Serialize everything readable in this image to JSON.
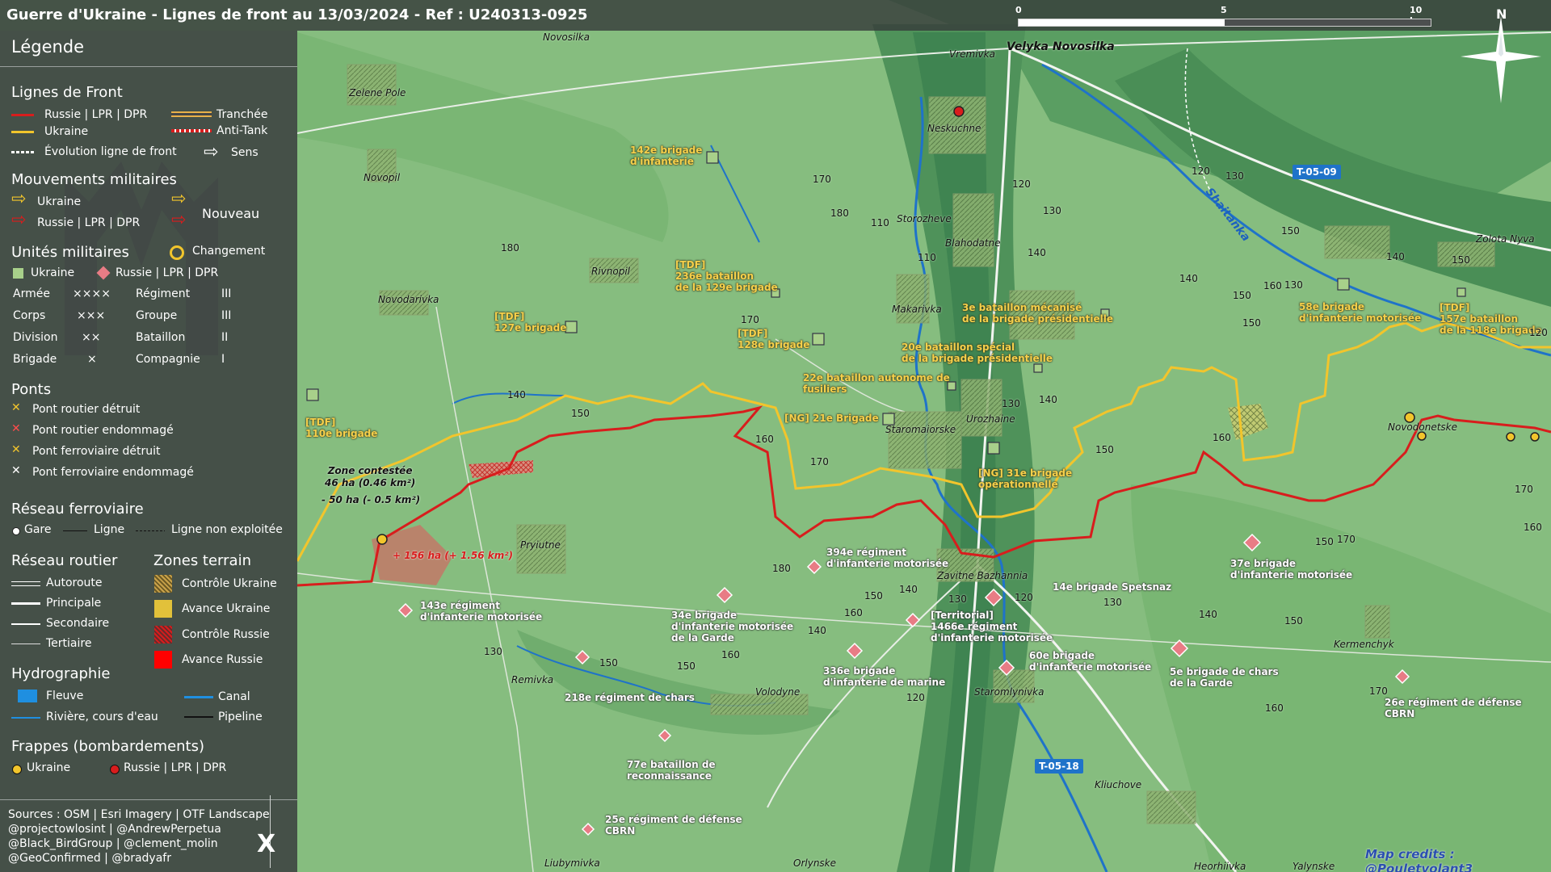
{
  "title": "Guerre d'Ukraine - Lignes de front au 13/03/2024 - Ref : U240313-0925",
  "scale": {
    "ticks": [
      "0",
      "5",
      "10 km"
    ]
  },
  "north": "N",
  "legend": {
    "header": "Légende",
    "front": {
      "title": "Lignes de Front",
      "russie": "Russie | LPR | DPR",
      "ukraine": "Ukraine",
      "tranchee": "Tranchée",
      "antitank": "Anti-Tank",
      "evolution": "Évolution ligne de front",
      "sens": "Sens"
    },
    "mouvements": {
      "title": "Mouvements militaires",
      "ukraine": "Ukraine",
      "russie": "Russie | LPR | DPR",
      "nouveau": "Nouveau"
    },
    "unites": {
      "title": "Unités militaires",
      "changement": "Changement",
      "ukraine": "Ukraine",
      "russie": "Russie | LPR | DPR",
      "rows": [
        {
          "a": "Armée",
          "as": "××××",
          "b": "Régiment",
          "bs": "III"
        },
        {
          "a": "Corps",
          "as": "×××",
          "b": "Groupe",
          "bs": "III"
        },
        {
          "a": "Division",
          "as": "××",
          "b": "Bataillon",
          "bs": "II"
        },
        {
          "a": "Brigade",
          "as": "×",
          "b": "Compagnie",
          "bs": "I"
        }
      ]
    },
    "ponts": {
      "title": "Ponts",
      "items": [
        "Pont routier détruit",
        "Pont routier endommagé",
        "Pont ferroviaire détruit",
        "Pont ferroviaire endommagé"
      ]
    },
    "rail": {
      "title": "Réseau ferroviaire",
      "gare": "Gare",
      "ligne": "Ligne",
      "non": "Ligne non exploitée"
    },
    "routier": {
      "title": "Réseau routier",
      "items": [
        "Autoroute",
        "Principale",
        "Secondaire",
        "Tertiaire"
      ]
    },
    "zones": {
      "title": "Zones terrain",
      "items": [
        "Contrôle Ukraine",
        "Avance Ukraine",
        "Contrôle Russie",
        "Avance Russie"
      ]
    },
    "hydro": {
      "title": "Hydrographie",
      "fleuve": "Fleuve",
      "canal": "Canal",
      "riviere": "Rivière, cours d'eau",
      "pipeline": "Pipeline"
    },
    "frappes": {
      "title": "Frappes (bombardements)",
      "ukraine": "Ukraine",
      "russie": "Russie | LPR | DPR"
    },
    "sources": [
      "Sources : OSM | Esri Imagery | OTF Landscape",
      "@projectowlosint | @AndrewPerpetua",
      "@Black_BirdGroup | @clement_molin",
      "@GeoConfirmed | @bradyafr"
    ],
    "x_logo": "X"
  },
  "colors": {
    "russia": "#d81d1d",
    "ukraine": "#f2c52c",
    "river": "#1f73c9",
    "panel": "#3e4442"
  },
  "places": [
    {
      "id": "novosilka",
      "name": "Novosilka"
    },
    {
      "id": "zelene-pole",
      "name": "Zelene Pole"
    },
    {
      "id": "vremivka",
      "name": "Vremivka"
    },
    {
      "id": "velyka-novosilka",
      "name": "Velyka Novosilka"
    },
    {
      "id": "neskuchne",
      "name": "Neskuchne"
    },
    {
      "id": "novopil",
      "name": "Novopil"
    },
    {
      "id": "storozheve",
      "name": "Storozheve"
    },
    {
      "id": "blahodatne",
      "name": "Blahodatne"
    },
    {
      "id": "rivnopil",
      "name": "Rivnopil"
    },
    {
      "id": "novodarivka",
      "name": "Novodarivka"
    },
    {
      "id": "makarivka",
      "name": "Makarivka"
    },
    {
      "id": "staromaiorske",
      "name": "Staromaiorske"
    },
    {
      "id": "urozhaine",
      "name": "Urozhaine"
    },
    {
      "id": "zolota-nyva",
      "name": "Zolota Nyva"
    },
    {
      "id": "novodonetske",
      "name": "Novodonetske"
    },
    {
      "id": "pryiutne",
      "name": "Pryiutne"
    },
    {
      "id": "zavitne-bazhannia",
      "name": "Zavitne Bazhannia"
    },
    {
      "id": "kermenchyk",
      "name": "Kermenchyk"
    },
    {
      "id": "remivka",
      "name": "Remivka"
    },
    {
      "id": "volodyne",
      "name": "Volodyne"
    },
    {
      "id": "staromlynivka",
      "name": "Staromlynivka"
    },
    {
      "id": "kliuchove",
      "name": "Kliuchove"
    },
    {
      "id": "orlynske",
      "name": "Orlynske"
    },
    {
      "id": "liubymivka",
      "name": "Liubymivka"
    },
    {
      "id": "heorhiivka",
      "name": "Heorhiivka"
    },
    {
      "id": "yalynske",
      "name": "Yalynske"
    }
  ],
  "roads": [
    "T-05-09",
    "T-05-18"
  ],
  "river_label": "Shaitanka",
  "units_ua": [
    "142e brigade\nd'infanterie",
    "[TDF]\n236e bataillon\nde la 129e brigade",
    "[TDF]\n127e brigade",
    "[TDF]\n128e brigade",
    "3e bataillon mécanisé\nde la brigade présidentielle",
    "20e bataillon spécial\nde la brigade présidentielle",
    "22e bataillon autonome de\nfusiliers",
    "[NG] 21e Brigade",
    "[NG] 31e brigade\nopérationnelle",
    "[TDF]\n110e brigade",
    "58e brigade\nd'infanterie motorisée",
    "[TDF]\n157e bataillon\nde la 118e brigade"
  ],
  "units_ru": [
    "394e régiment\nd'infanterie motorisée",
    "143e régiment\nd'infanterie motorisée",
    "34e brigade\nd'infanterie motorisée\nde la Garde",
    "[Territorial]\n1466e régiment\nd'infanterie motorisée",
    "14e brigade Spetsnaz",
    "336e brigade\nd'infanterie de marine",
    "60e brigade\nd'infanterie motorisée",
    "5e brigade de chars\nde la Garde",
    "37e brigade\nd'infanterie motorisée",
    "26e régiment de défense\nCBRN",
    "218e régiment de chars",
    "77e bataillon de\nreconnaissance",
    "25e régiment de défense\nCBRN"
  ],
  "contested": {
    "title": "Zone contestée",
    "area": "46 ha (0.46 km²)",
    "loss": "- 50 ha (- 0.5 km²)",
    "gain": "+ 156 ha (+ 1.56 km²)"
  },
  "elevations": [
    "170",
    "180",
    "110",
    "120",
    "130",
    "110",
    "140",
    "180",
    "150",
    "170",
    "140",
    "150",
    "160",
    "170",
    "130",
    "140",
    "160",
    "150",
    "180",
    "150",
    "140",
    "130",
    "150",
    "160",
    "120",
    "130",
    "150",
    "160",
    "170",
    "140",
    "150",
    "130",
    "150",
    "120",
    "140",
    "160",
    "120",
    "130",
    "150",
    "140",
    "170",
    "130",
    "140",
    "160",
    "150",
    "170",
    "160",
    "150",
    "120"
  ],
  "credits": "Map credits : @Pouletvolant3"
}
